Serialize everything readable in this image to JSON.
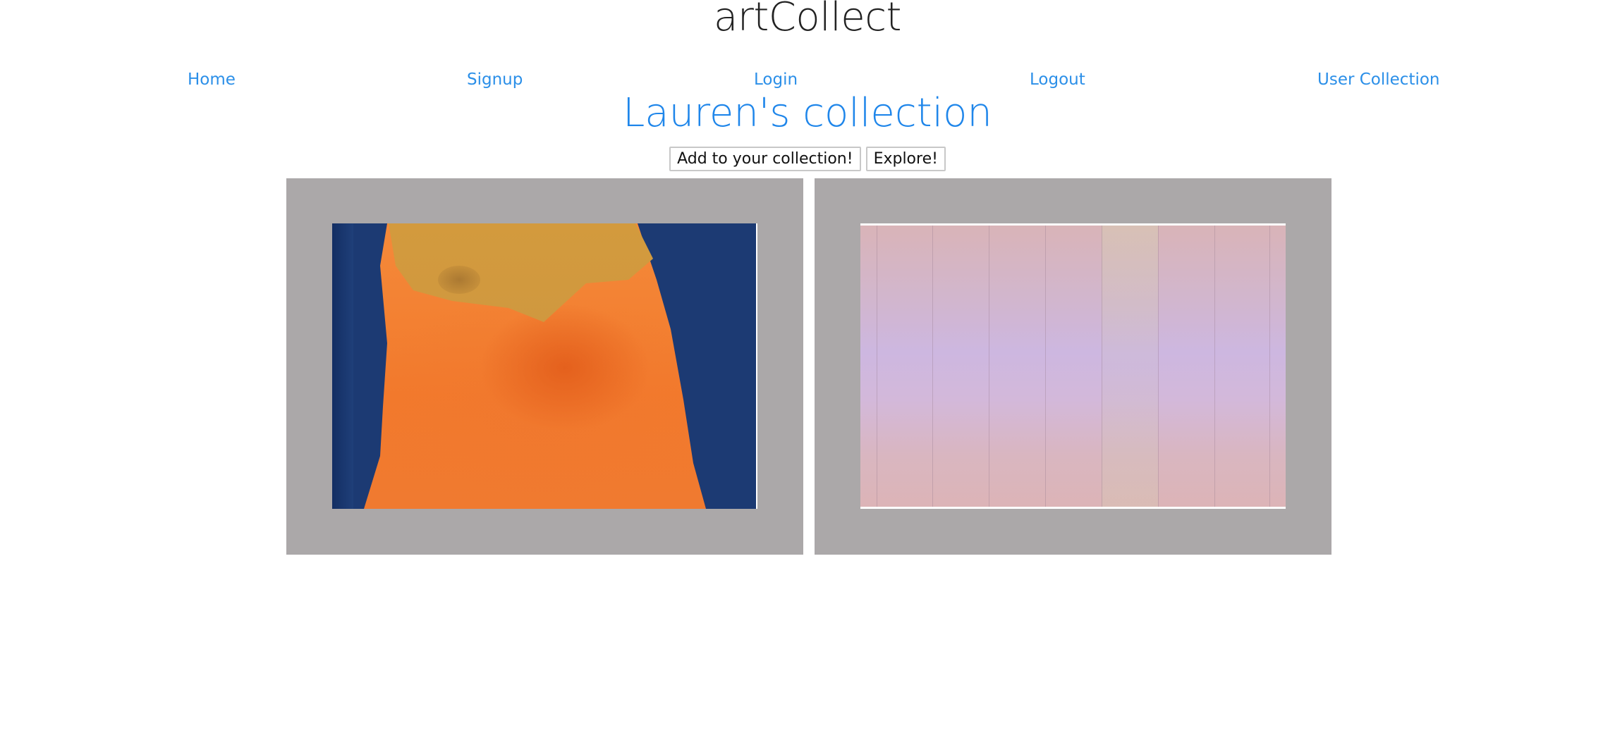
{
  "header": {
    "app_title": "artCollect"
  },
  "nav": {
    "items": [
      {
        "label": "Home"
      },
      {
        "label": "Signup"
      },
      {
        "label": "Login"
      },
      {
        "label": "Logout"
      },
      {
        "label": "User Collection"
      }
    ]
  },
  "collection": {
    "title": "Lauren's collection",
    "add_button_label": "Add to your collection!",
    "explore_button_label": "Explore!",
    "artworks": [
      {
        "description": "orange-and-blue-painting"
      },
      {
        "description": "pastel-striped-painting"
      }
    ]
  },
  "colors": {
    "link": "#2b8fe8",
    "heading_accent": "#1f86ea",
    "card_background": "#aba8a9"
  }
}
